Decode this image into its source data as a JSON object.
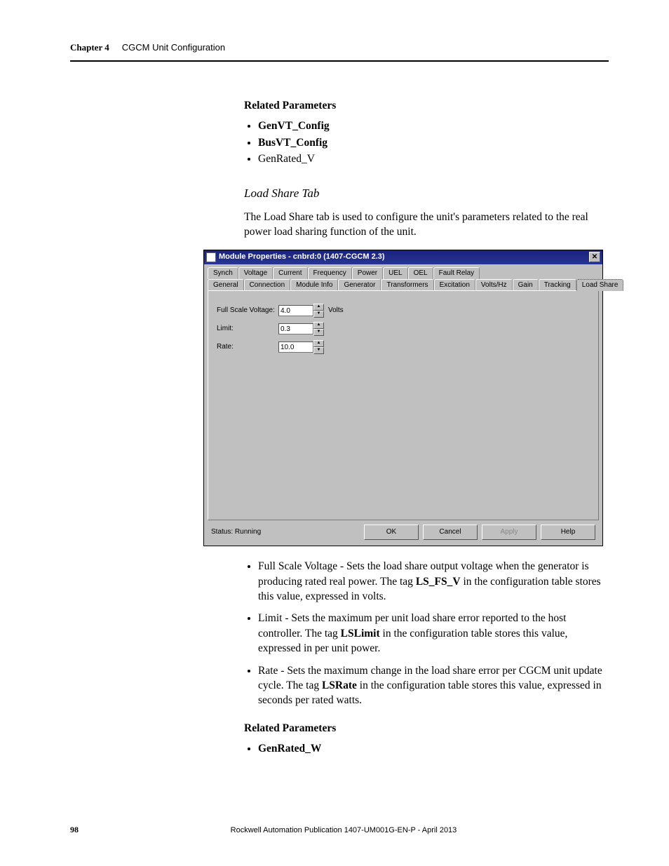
{
  "header": {
    "chapter_label": "Chapter 4",
    "chapter_title": "CGCM Unit Configuration"
  },
  "section1": {
    "heading": "Related Parameters",
    "items": [
      "GenVT_Config",
      "BusVT_Config",
      "GenRated_V"
    ]
  },
  "section2": {
    "heading": "Load Share Tab",
    "para": "The Load Share tab is used to configure the unit's parameters related to the real power load sharing function of the unit."
  },
  "dialog": {
    "title": "Module Properties - cnbrd:0 (1407-CGCM 2.3)",
    "tabs_row1": [
      "Synch",
      "Voltage",
      "Current",
      "Frequency",
      "Power",
      "UEL",
      "OEL",
      "Fault Relay"
    ],
    "tabs_row2": [
      "General",
      "Connection",
      "Module Info",
      "Generator",
      "Transformers",
      "Excitation",
      "Volts/Hz",
      "Gain",
      "Tracking",
      "Load Share"
    ],
    "active_tab": "Load Share",
    "fields": {
      "full_scale_voltage": {
        "label": "Full Scale Voltage:",
        "value": "4.0",
        "unit": "Volts"
      },
      "limit": {
        "label": "Limit:",
        "value": "0.3"
      },
      "rate": {
        "label": "Rate:",
        "value": "10.0"
      }
    },
    "status_label": "Status: Running",
    "buttons": {
      "ok": "OK",
      "cancel": "Cancel",
      "apply": "Apply",
      "help": "Help"
    }
  },
  "bullets": [
    {
      "lead": "Full Scale Voltage - Sets the load share output voltage when the generator is producing rated real power. The tag ",
      "tag": "LS_FS_V",
      "tail": " in the configuration table stores this value, expressed in volts."
    },
    {
      "lead": "Limit - Sets the maximum per unit load share error reported to the host controller. The tag ",
      "tag": "LSLimit",
      "tail": " in the configuration table stores this value, expressed in per unit power."
    },
    {
      "lead": "Rate - Sets the maximum change in the load share error per CGCM unit update cycle. The tag ",
      "tag": "LSRate",
      "tail": " in the configuration table stores this value, expressed in seconds per rated watts."
    }
  ],
  "section3": {
    "heading": "Related Parameters",
    "items": [
      "GenRated_W"
    ]
  },
  "footer": {
    "page": "98",
    "pub": "Rockwell Automation Publication 1407-UM001G-EN-P - April 2013"
  }
}
